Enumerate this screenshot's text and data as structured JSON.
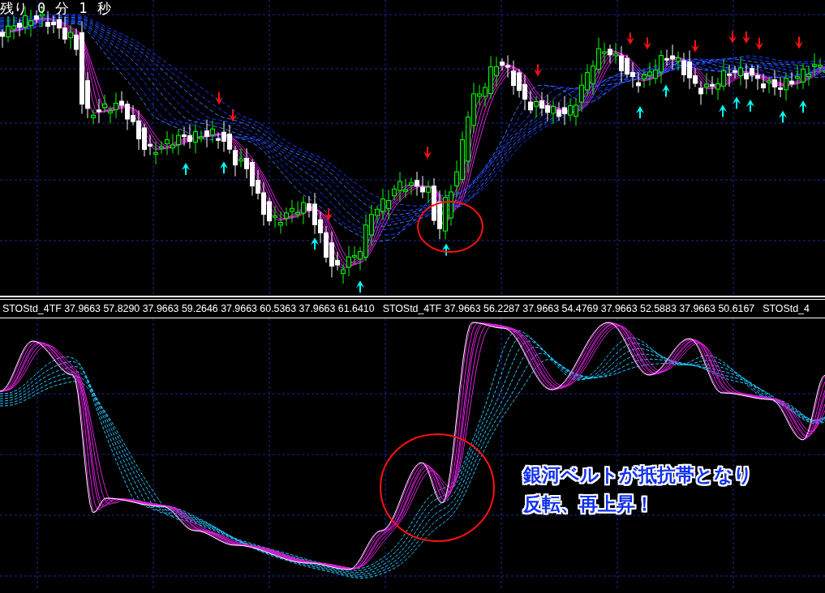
{
  "timer": {
    "label": "残り",
    "minutes": "0",
    "minutes_unit": "分",
    "seconds": "1",
    "seconds_unit": "秒"
  },
  "indicator_labels": [
    "STOStd_4TF 37.9663 57.8290 37.9663 59.2646 37.9663 60.5363 37.9663 61.6410",
    "STOStd_4TF 37.9663 56.2287 37.9663 54.4769 37.9663 52.5883 37.9663 50.6167",
    "STOStd_4"
  ],
  "annotation": {
    "lines": [
      "銀河ベルトが抵抗帯となり",
      "反転、再上昇！"
    ]
  }
}
